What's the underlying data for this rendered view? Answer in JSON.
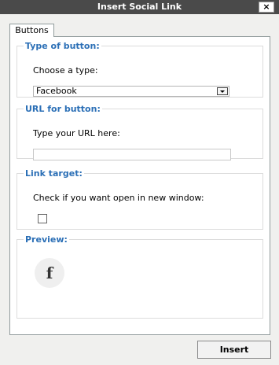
{
  "dialog": {
    "title": "Insert Social Link",
    "close_label": "×"
  },
  "tabs": [
    {
      "label": "Buttons"
    }
  ],
  "type_section": {
    "legend": "Type of button:",
    "label": "Choose a type:",
    "selected": "Facebook"
  },
  "url_section": {
    "legend": "URL for button:",
    "label": "Type your URL here:",
    "value": ""
  },
  "target_section": {
    "legend": "Link target:",
    "label": "Check if you want open in new window:",
    "checked": false
  },
  "preview_section": {
    "legend": "Preview:",
    "icon_glyph": "f"
  },
  "footer": {
    "insert_label": "Insert"
  },
  "colors": {
    "titlebar": "#4a4a4a",
    "legend": "#2b6fb6",
    "dialog_bg": "#f0f0ee"
  },
  "icons": [
    "close-icon",
    "dropdown-arrow-icon",
    "facebook-icon"
  ]
}
